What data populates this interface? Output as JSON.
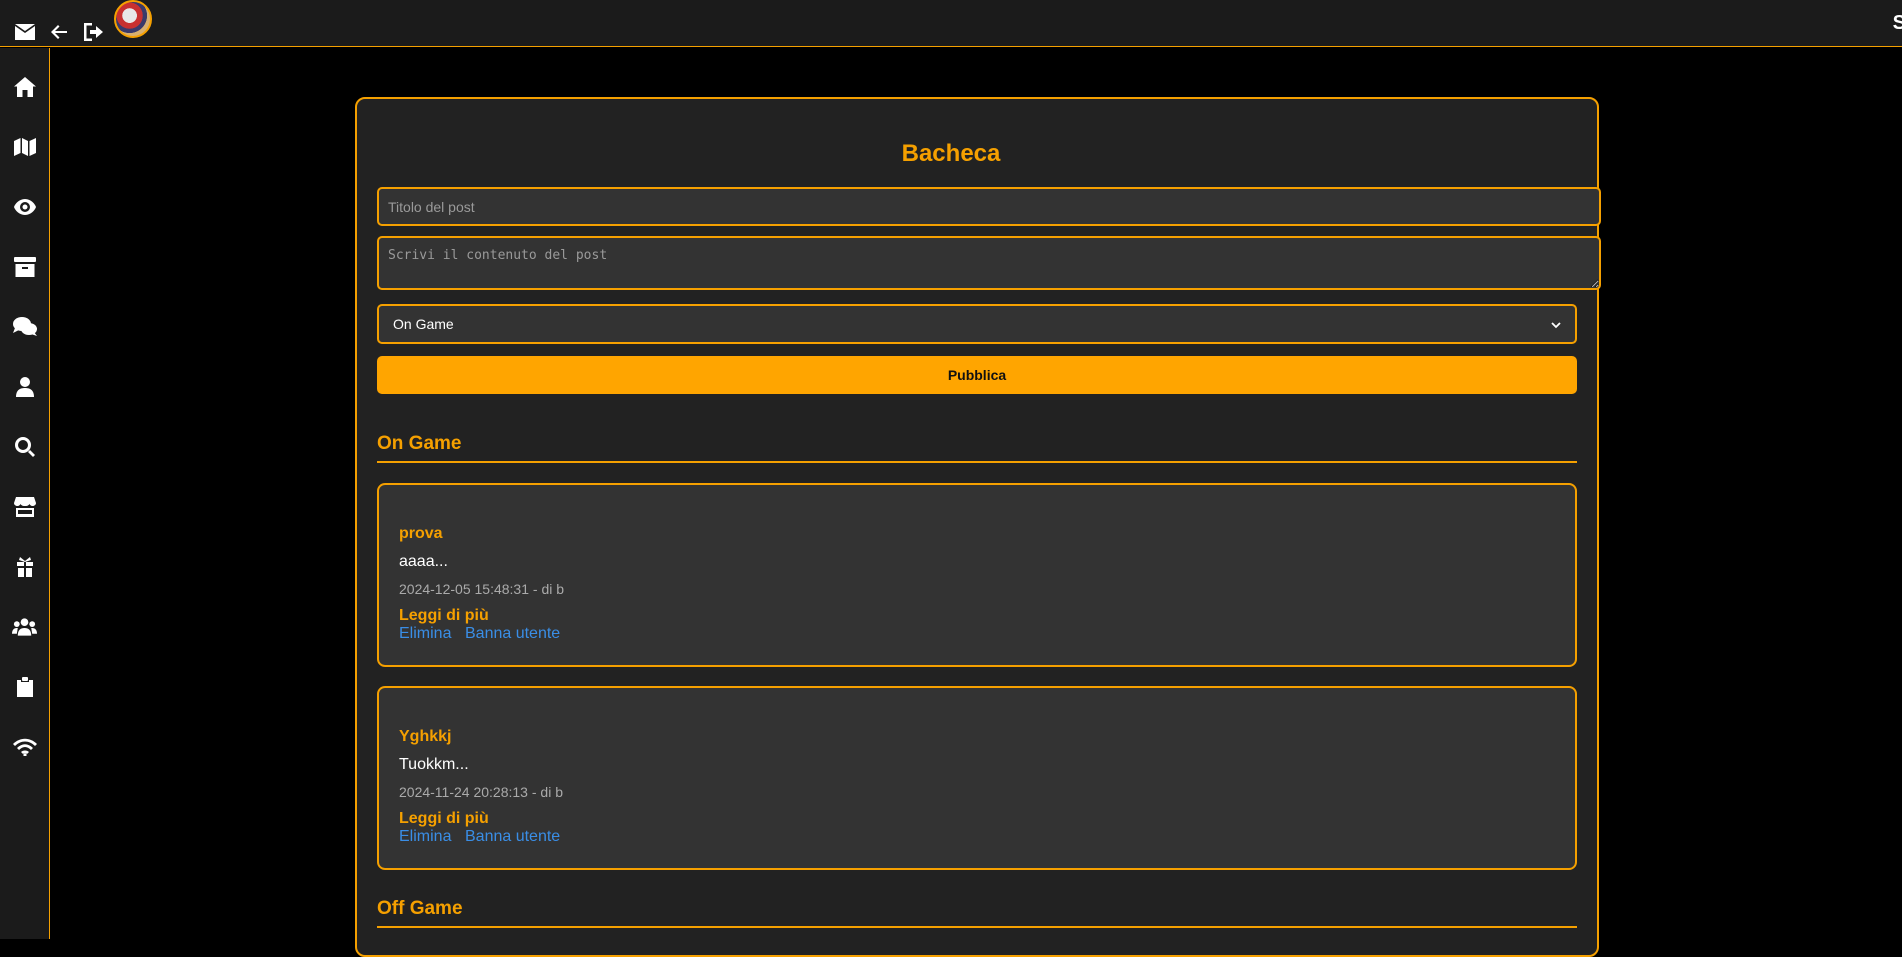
{
  "header": {
    "right_text": "S"
  },
  "sidebar": {
    "items": [
      {
        "icon": "home-icon"
      },
      {
        "icon": "map-icon"
      },
      {
        "icon": "eye-icon"
      },
      {
        "icon": "archive-icon"
      },
      {
        "icon": "chat-icon"
      },
      {
        "icon": "user-icon"
      },
      {
        "icon": "search-icon"
      },
      {
        "icon": "store-icon"
      },
      {
        "icon": "gift-icon"
      },
      {
        "icon": "users-icon"
      },
      {
        "icon": "clipboard-icon"
      },
      {
        "icon": "wifi-icon"
      }
    ]
  },
  "board": {
    "title": "Bacheca",
    "title_placeholder": "Titolo del post",
    "content_placeholder": "Scrivi il contenuto del post",
    "category_selected": "On Game",
    "publish_label": "Pubblica"
  },
  "sections": [
    {
      "name": "On Game",
      "posts": [
        {
          "title": "prova",
          "excerpt": "aaaa...",
          "meta": "2024-12-05 15:48:31 - di b",
          "read_more": "Leggi di più",
          "delete": "Elimina",
          "ban": "Banna utente"
        },
        {
          "title": "Yghkkj",
          "excerpt": "Tuokkm...",
          "meta": "2024-11-24 20:28:13 - di b",
          "read_more": "Leggi di più",
          "delete": "Elimina",
          "ban": "Banna utente"
        }
      ]
    },
    {
      "name": "Off Game",
      "posts": []
    }
  ],
  "colors": {
    "accent": "#ffa500",
    "link": "#3a8ee6",
    "panel": "#333333",
    "background": "#000000"
  }
}
